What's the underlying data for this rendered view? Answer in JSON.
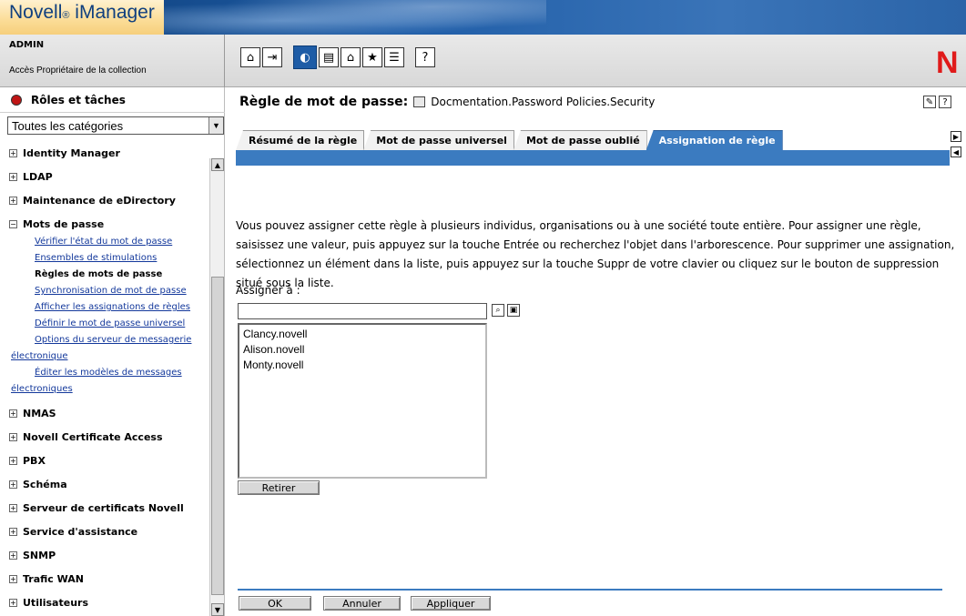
{
  "header": {
    "brand": "Novell",
    "brand_reg": "®",
    "brand_product": " iManager",
    "user": "ADMIN",
    "collection": "Accès Propriétaire de la collection",
    "logo_letter": "N",
    "toolbar_icons": [
      "home-icon",
      "exit-icon",
      "roles-tasks-icon",
      "view-objects-icon",
      "configure-icon",
      "favorites-icon",
      "preferences-icon",
      "help-icon"
    ]
  },
  "sidebar": {
    "title": "Rôles et tâches",
    "category_select": "Toutes les catégories",
    "categories": [
      {
        "label": "Identity Manager",
        "expanded": false
      },
      {
        "label": "LDAP",
        "expanded": false
      },
      {
        "label": "Maintenance de eDirectory",
        "expanded": false
      },
      {
        "label": "Mots de passe",
        "expanded": true
      },
      {
        "label": "NMAS",
        "expanded": false
      },
      {
        "label": "Novell Certificate Access",
        "expanded": false
      },
      {
        "label": "PBX",
        "expanded": false
      },
      {
        "label": "Schéma",
        "expanded": false
      },
      {
        "label": "Serveur de certificats Novell",
        "expanded": false
      },
      {
        "label": "Service d'assistance",
        "expanded": false
      },
      {
        "label": "SNMP",
        "expanded": false
      },
      {
        "label": "Trafic WAN",
        "expanded": false
      },
      {
        "label": "Utilisateurs",
        "expanded": false
      }
    ],
    "password_items": [
      "Vérifier l'état du mot de passe",
      "Ensembles de stimulations",
      "Règles de mots de passe",
      "Synchronisation de mot de passe",
      "Afficher les assignations de règles",
      "Définir le mot de passe universel",
      "Options du serveur de messagerie",
      "électronique",
      "Éditer les modèles de messages",
      "électroniques"
    ],
    "active_item": "Règles de mots de passe"
  },
  "main": {
    "title": "Règle de mot de passe:",
    "object": "Docmentation.Password Policies.Security",
    "tabs": [
      {
        "label": "Résumé de la règle",
        "active": false
      },
      {
        "label": "Mot de passe universel",
        "active": false
      },
      {
        "label": "Mot de passe oublié",
        "active": false
      },
      {
        "label": "Assignation de règle",
        "active": true
      }
    ],
    "description": "Vous pouvez assigner cette règle à plusieurs individus, organisations ou à une société toute entière. Pour assigner une règle, saisissez une valeur, puis appuyez sur la touche Entrée ou recherchez l'objet dans l'arborescence. Pour supprimer une assignation, sélectionnez un élément dans la liste, puis appuyez sur la touche Suppr de votre clavier ou cliquez sur le bouton de suppression situé sous la liste.",
    "assign_label": "Assigner à :",
    "assign_value": "",
    "assignments": [
      "Clancy.novell",
      "Alison.novell",
      "Monty.novell"
    ],
    "remove_button": "Retirer",
    "ok_button": "OK",
    "cancel_button": "Annuler",
    "apply_button": "Appliquer"
  }
}
